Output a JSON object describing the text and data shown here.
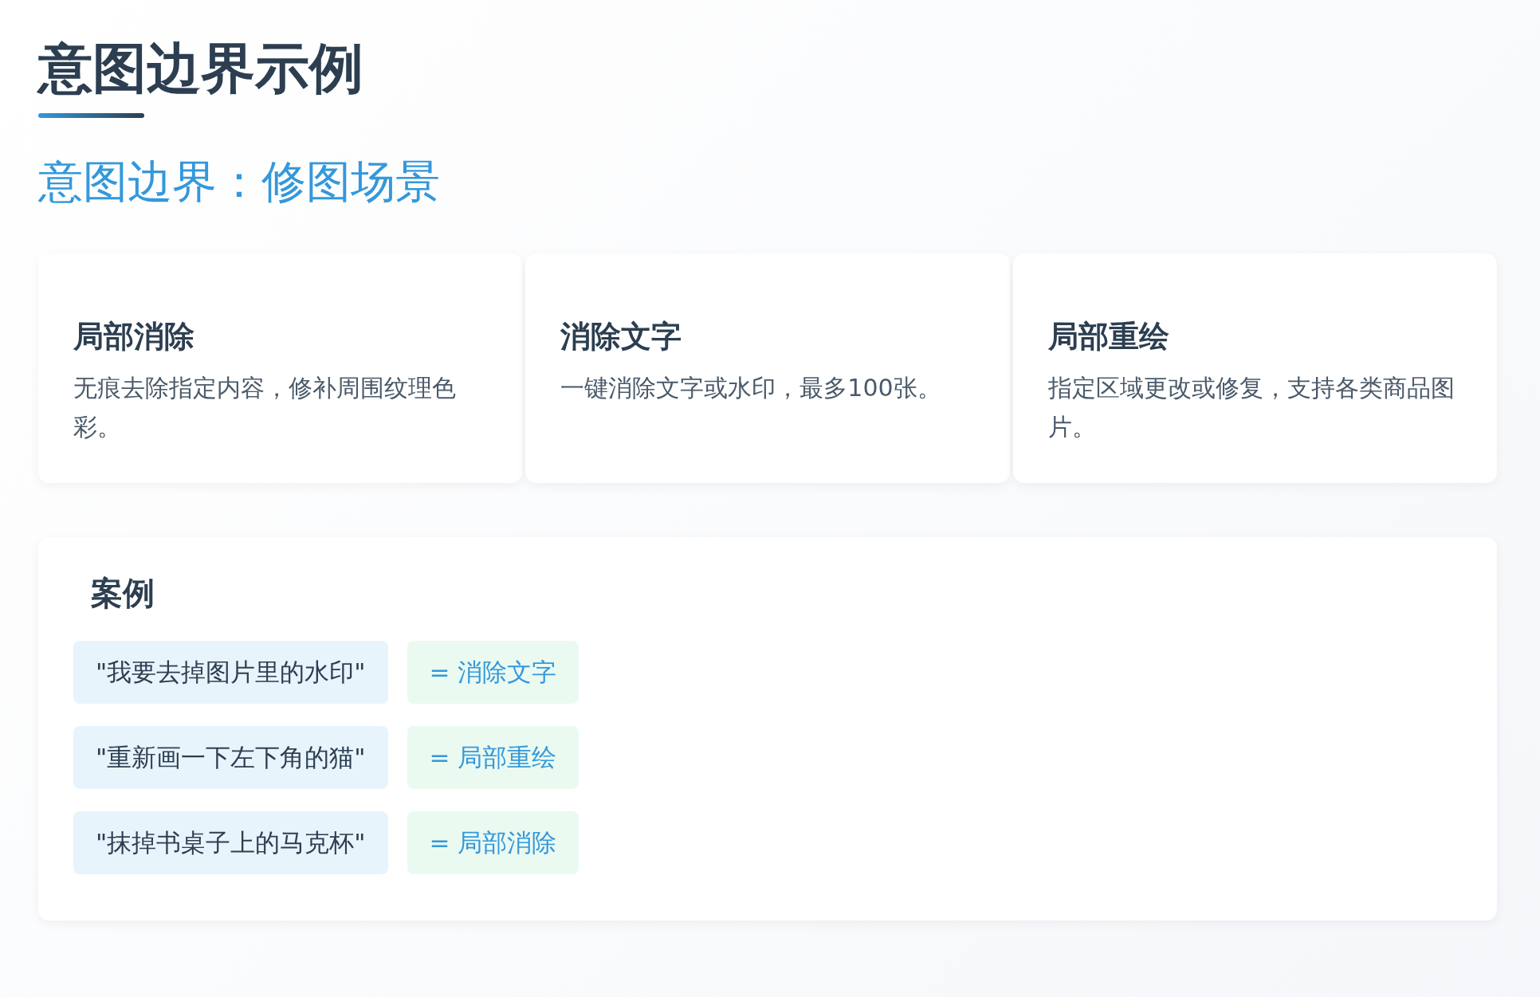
{
  "title": "意图边界示例",
  "subtitle": "意图边界：修图场景",
  "cards": [
    {
      "title": "局部消除",
      "description": "无痕去除指定内容，修补周围纹理色彩。"
    },
    {
      "title": "消除文字",
      "description": "一键消除文字或水印，最多100张。"
    },
    {
      "title": "局部重绘",
      "description": "指定区域更改或修复，支持各类商品图片。"
    }
  ],
  "examples": {
    "heading": "案例",
    "rows": [
      {
        "utterance": "\"我要去掉图片里的水印\"",
        "intent": "= 消除文字"
      },
      {
        "utterance": "\"重新画一下左下角的猫\"",
        "intent": "= 局部重绘"
      },
      {
        "utterance": "\"抹掉书桌子上的马克杯\"",
        "intent": "= 局部消除"
      }
    ]
  }
}
